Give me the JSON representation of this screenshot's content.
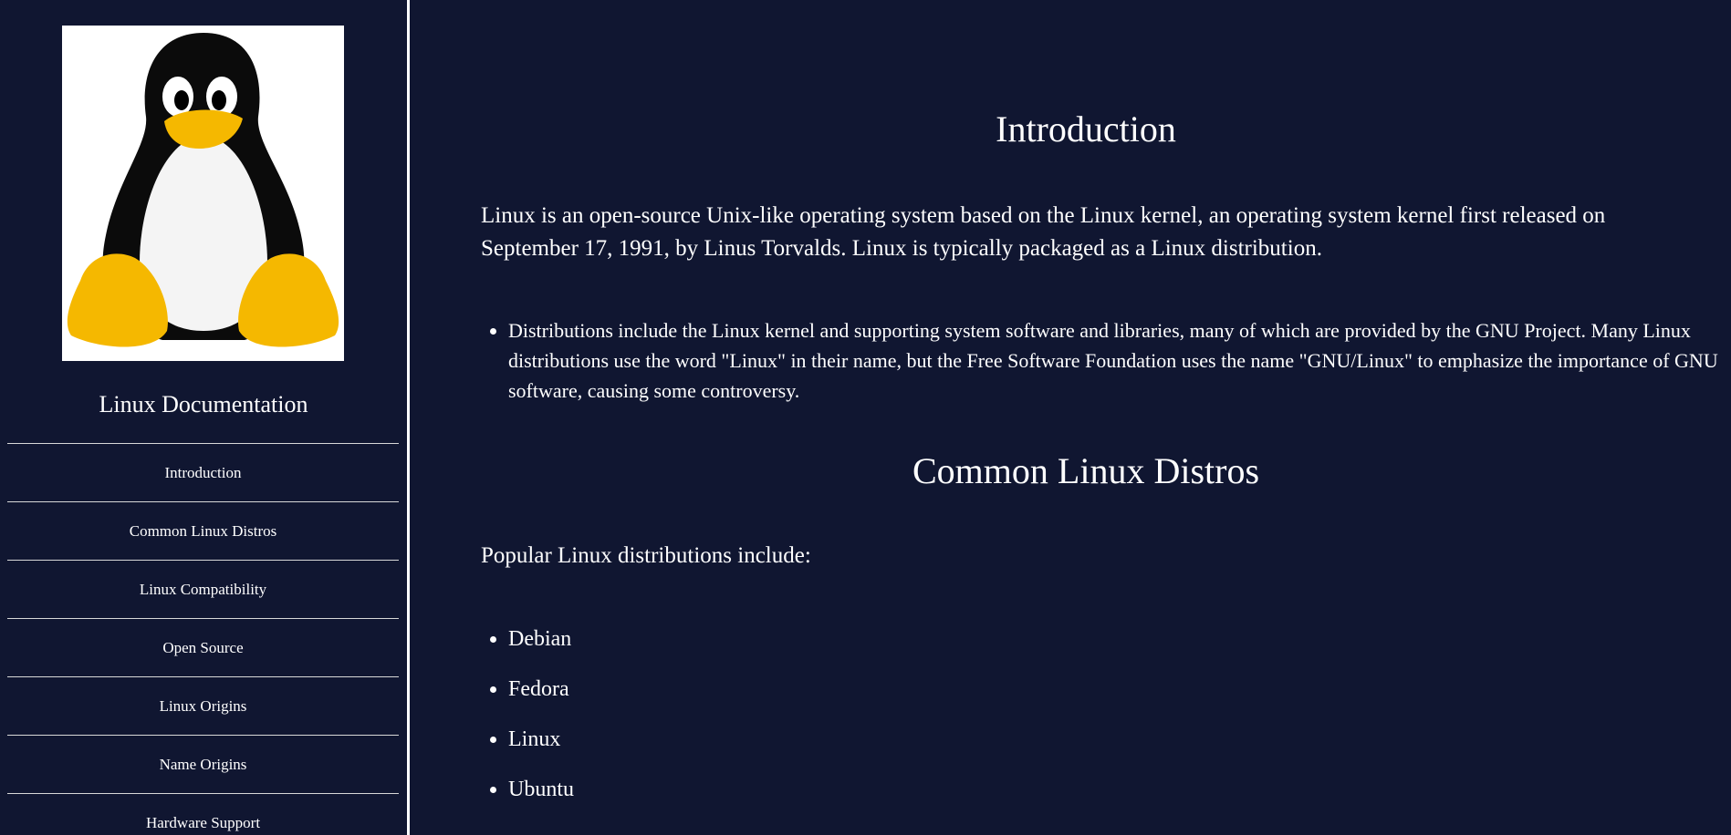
{
  "sidebar": {
    "title": "Linux Documentation",
    "nav": [
      {
        "label": "Introduction"
      },
      {
        "label": "Common Linux Distros"
      },
      {
        "label": "Linux Compatibility"
      },
      {
        "label": "Open Source"
      },
      {
        "label": "Linux Origins"
      },
      {
        "label": "Name Origins"
      },
      {
        "label": "Hardware Support"
      }
    ]
  },
  "main": {
    "intro": {
      "heading": "Introduction",
      "paragraph": "Linux is an open-source Unix-like operating system based on the Linux kernel, an operating system kernel first released on September 17, 1991, by Linus Torvalds. Linux is typically packaged as a Linux distribution.",
      "bullets": [
        "Distributions include the Linux kernel and supporting system software and libraries, many of which are provided by the GNU Project. Many Linux distributions use the word \"Linux\" in their name, but the Free Software Foundation uses the name \"GNU/Linux\" to emphasize the importance of GNU software, causing some controversy."
      ]
    },
    "distros": {
      "heading": "Common Linux Distros",
      "paragraph": "Popular Linux distributions include:",
      "items": [
        "Debian",
        "Fedora",
        "Linux",
        "Ubuntu"
      ]
    }
  },
  "colors": {
    "background": "#101631",
    "text": "#ffffff",
    "penguin_beak": "#f5b800"
  }
}
